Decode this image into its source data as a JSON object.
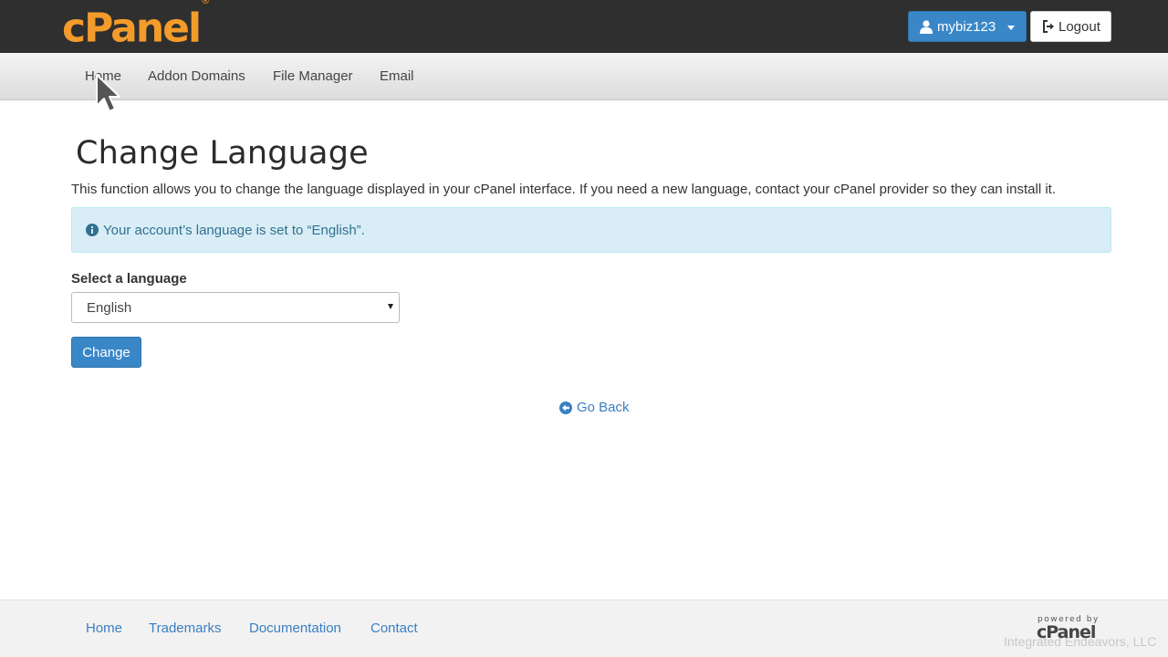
{
  "header": {
    "logo_text": "cPanel",
    "logo_mark": "®",
    "user_label": "mybiz123",
    "logout_label": "Logout",
    "icons": {
      "user": "user-icon",
      "logout": "logout-icon",
      "caret": "caret-down-icon"
    }
  },
  "nav": {
    "items": [
      {
        "label": "Home"
      },
      {
        "label": "Addon Domains"
      },
      {
        "label": "File Manager"
      },
      {
        "label": "Email"
      }
    ]
  },
  "main": {
    "title": "Change Language",
    "description": "This function allows you to change the language displayed in your cPanel interface. If you need a new language, contact your cPanel provider so they can install it.",
    "alert_text": "Your account’s language is set to “English”.",
    "select_label": "Select a language",
    "selected_language": "English",
    "change_label": "Change",
    "go_back_label": "Go Back"
  },
  "footer": {
    "links": [
      {
        "label": "Home"
      },
      {
        "label": "Trademarks"
      },
      {
        "label": "Documentation"
      },
      {
        "label": "Contact"
      }
    ],
    "powered_by": "powered by",
    "powered_logo": "cPanel",
    "watermark": "Integrated Endeavors, LLC"
  },
  "colors": {
    "topbar": "#2f2f2f",
    "logo": "#f39c2b",
    "primary": "#3a87c8",
    "link": "#3a7fc1",
    "alert_bg": "#d9edf7",
    "alert_text": "#31708f"
  }
}
